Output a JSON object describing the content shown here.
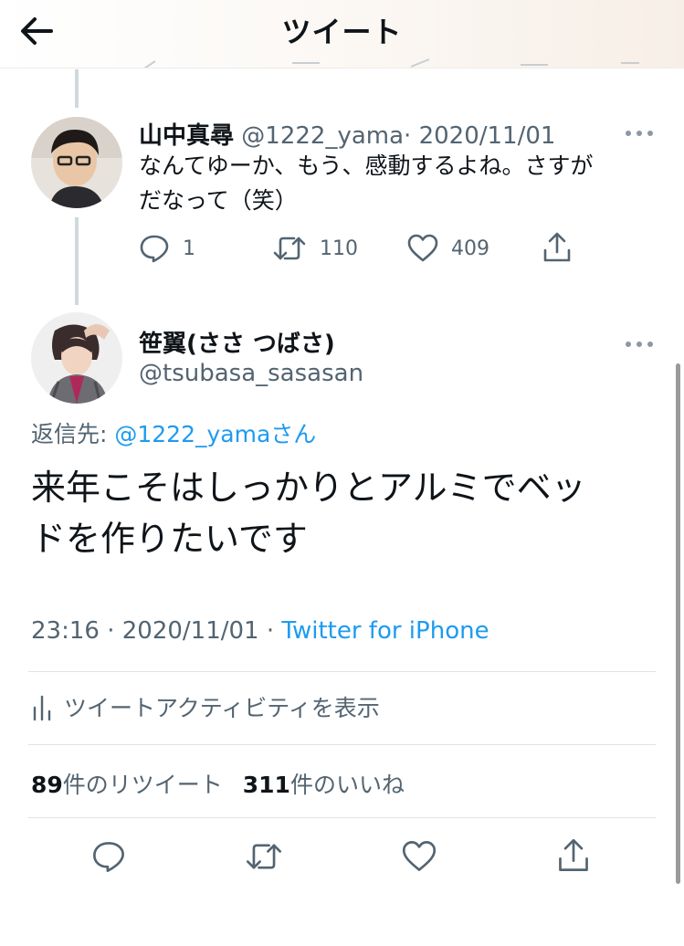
{
  "header": {
    "title": "ツイート"
  },
  "parent_tweet": {
    "name": "山中真尋",
    "handle": "@1222_yama",
    "separator": "·",
    "date": "2020/11/01",
    "text_line1": "なんてゆーか、もう、感動するよね。さすが",
    "text_line2": "だなって（笑）",
    "replies": "1",
    "retweets": "110",
    "likes": "409"
  },
  "main_tweet": {
    "name": "笹翼(ささ つばさ)",
    "handle": "@tsubasa_sasasan",
    "reply_prefix": "返信先: ",
    "reply_to": "@1222_yamaさん",
    "text_line1": "来年こそはしっかりとアルミでベッ",
    "text_line2": "ドを作りたいです",
    "time": "23:16",
    "date": "2020/11/01",
    "source": "Twitter for iPhone",
    "sep": " · ",
    "activity_label": "ツイートアクティビティを表示",
    "retweet_count": "89",
    "retweet_label": "件のリツイート",
    "like_count": "311",
    "like_label": "件のいいね"
  },
  "colors": {
    "accent": "#1d9bf0",
    "muted": "#536471",
    "thread": "#cfd9de"
  },
  "icons": [
    "back-arrow-icon",
    "more-icon",
    "reply-icon",
    "retweet-icon",
    "like-icon",
    "share-icon",
    "analytics-icon"
  ]
}
